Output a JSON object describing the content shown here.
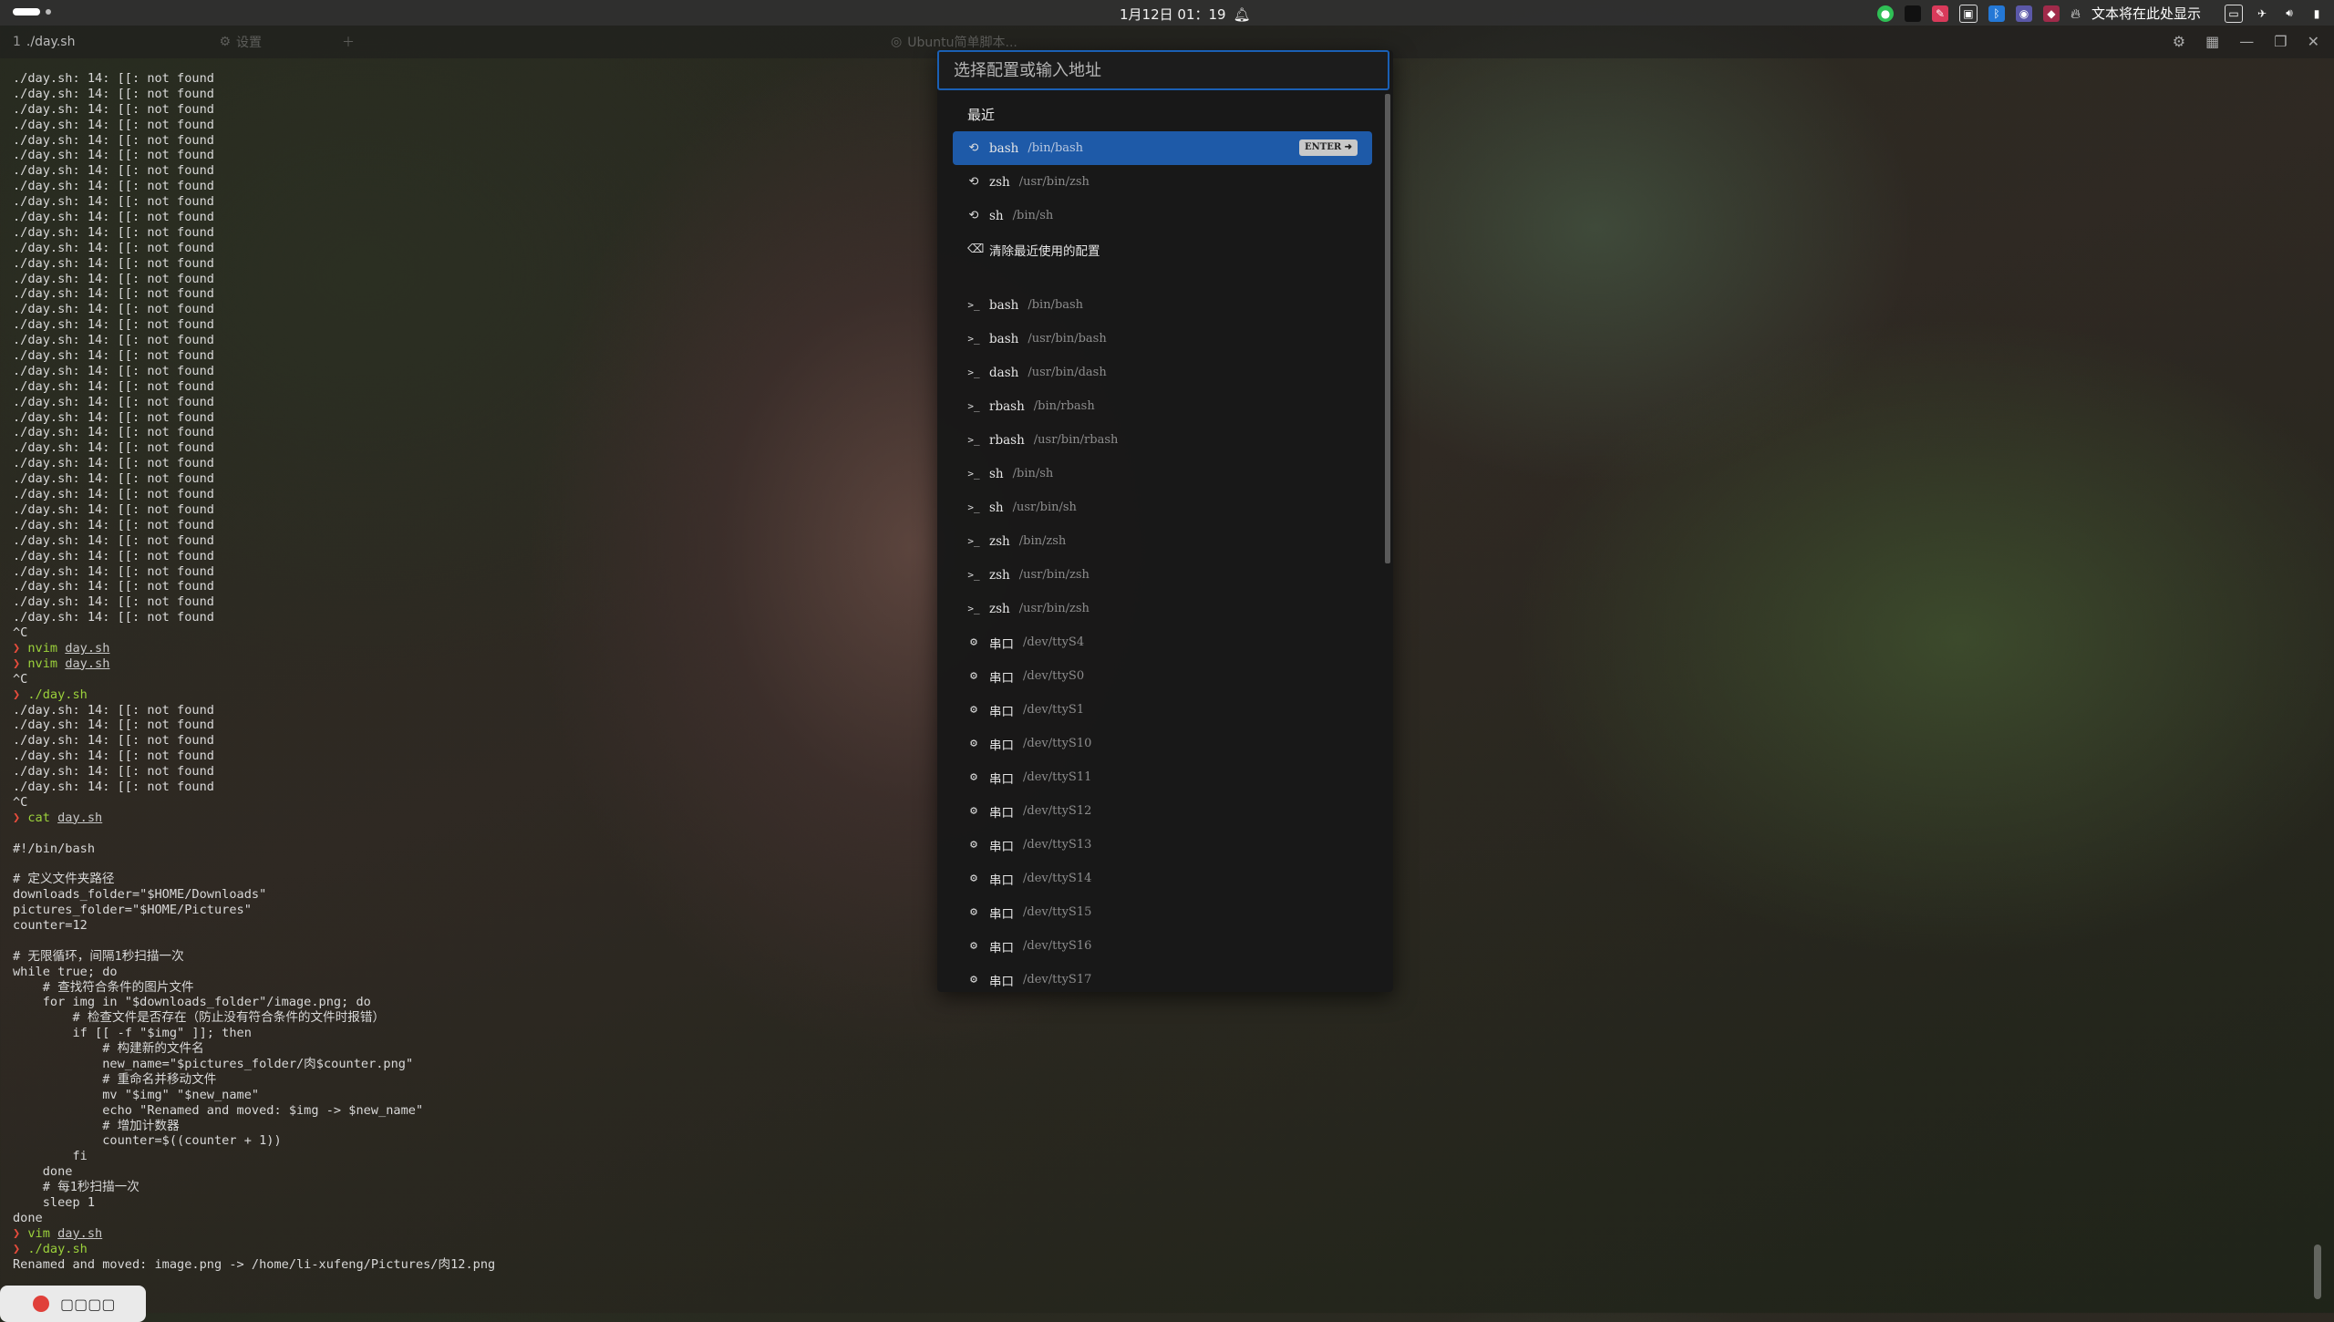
{
  "topbar": {
    "datetime": "1月12日 01：19",
    "tray_text": "文本将在此处显示",
    "tray_icons": [
      "wechat-icon",
      "app-square-icon",
      "app-red-icon",
      "app-window-icon",
      "bluetooth-icon",
      "app-bot-icon",
      "app-red2-icon",
      "flame-icon",
      "screen-icon",
      "network-icon",
      "volume-icon",
      "battery-icon"
    ]
  },
  "tabs": [
    {
      "idx": "1",
      "label": "./day.sh",
      "dim": false
    },
    {
      "idx": "",
      "label": "设置",
      "dim": true
    },
    {
      "idx": "",
      "label": "Ubuntu简单脚本...",
      "dim": true
    }
  ],
  "terminal": {
    "lines": [
      {
        "t": "out",
        "text": "./day.sh: 14: [[: not found"
      },
      {
        "t": "out",
        "text": "./day.sh: 14: [[: not found"
      },
      {
        "t": "out",
        "text": "./day.sh: 14: [[: not found"
      },
      {
        "t": "out",
        "text": "./day.sh: 14: [[: not found"
      },
      {
        "t": "out",
        "text": "./day.sh: 14: [[: not found"
      },
      {
        "t": "out",
        "text": "./day.sh: 14: [[: not found"
      },
      {
        "t": "out",
        "text": "./day.sh: 14: [[: not found"
      },
      {
        "t": "out",
        "text": "./day.sh: 14: [[: not found"
      },
      {
        "t": "out",
        "text": "./day.sh: 14: [[: not found"
      },
      {
        "t": "out",
        "text": "./day.sh: 14: [[: not found"
      },
      {
        "t": "out",
        "text": "./day.sh: 14: [[: not found"
      },
      {
        "t": "out",
        "text": "./day.sh: 14: [[: not found"
      },
      {
        "t": "out",
        "text": "./day.sh: 14: [[: not found"
      },
      {
        "t": "out",
        "text": "./day.sh: 14: [[: not found"
      },
      {
        "t": "out",
        "text": "./day.sh: 14: [[: not found"
      },
      {
        "t": "out",
        "text": "./day.sh: 14: [[: not found"
      },
      {
        "t": "out",
        "text": "./day.sh: 14: [[: not found"
      },
      {
        "t": "out",
        "text": "./day.sh: 14: [[: not found"
      },
      {
        "t": "out",
        "text": "./day.sh: 14: [[: not found"
      },
      {
        "t": "out",
        "text": "./day.sh: 14: [[: not found"
      },
      {
        "t": "out",
        "text": "./day.sh: 14: [[: not found"
      },
      {
        "t": "out",
        "text": "./day.sh: 14: [[: not found"
      },
      {
        "t": "out",
        "text": "./day.sh: 14: [[: not found"
      },
      {
        "t": "out",
        "text": "./day.sh: 14: [[: not found"
      },
      {
        "t": "out",
        "text": "./day.sh: 14: [[: not found"
      },
      {
        "t": "out",
        "text": "./day.sh: 14: [[: not found"
      },
      {
        "t": "out",
        "text": "./day.sh: 14: [[: not found"
      },
      {
        "t": "out",
        "text": "./day.sh: 14: [[: not found"
      },
      {
        "t": "out",
        "text": "./day.sh: 14: [[: not found"
      },
      {
        "t": "out",
        "text": "./day.sh: 14: [[: not found"
      },
      {
        "t": "out",
        "text": "./day.sh: 14: [[: not found"
      },
      {
        "t": "out",
        "text": "./day.sh: 14: [[: not found"
      },
      {
        "t": "out",
        "text": "./day.sh: 14: [[: not found"
      },
      {
        "t": "out",
        "text": "./day.sh: 14: [[: not found"
      },
      {
        "t": "out",
        "text": "./day.sh: 14: [[: not found"
      },
      {
        "t": "out",
        "text": "./day.sh: 14: [[: not found"
      },
      {
        "t": "out",
        "text": "^C"
      },
      {
        "t": "cmd",
        "cmd": "nvim",
        "arg": "day.sh"
      },
      {
        "t": "cmd",
        "cmd": "nvim",
        "arg": "day.sh"
      },
      {
        "t": "out",
        "text": "^C"
      },
      {
        "t": "cmd",
        "cmd": "./day.sh",
        "arg": ""
      },
      {
        "t": "out",
        "text": "./day.sh: 14: [[: not found"
      },
      {
        "t": "out",
        "text": "./day.sh: 14: [[: not found"
      },
      {
        "t": "out",
        "text": "./day.sh: 14: [[: not found"
      },
      {
        "t": "out",
        "text": "./day.sh: 14: [[: not found"
      },
      {
        "t": "out",
        "text": "./day.sh: 14: [[: not found"
      },
      {
        "t": "out",
        "text": "./day.sh: 14: [[: not found"
      },
      {
        "t": "out",
        "text": "^C"
      },
      {
        "t": "cmd",
        "cmd": "cat",
        "arg": "day.sh"
      },
      {
        "t": "out",
        "text": ""
      },
      {
        "t": "out",
        "text": "#!/bin/bash"
      },
      {
        "t": "out",
        "text": ""
      },
      {
        "t": "out",
        "text": "# 定义文件夹路径"
      },
      {
        "t": "out",
        "text": "downloads_folder=\"$HOME/Downloads\""
      },
      {
        "t": "out",
        "text": "pictures_folder=\"$HOME/Pictures\""
      },
      {
        "t": "out",
        "text": "counter=12"
      },
      {
        "t": "out",
        "text": ""
      },
      {
        "t": "out",
        "text": "# 无限循环，间隔1秒扫描一次"
      },
      {
        "t": "out",
        "text": "while true; do"
      },
      {
        "t": "out",
        "text": "    # 查找符合条件的图片文件"
      },
      {
        "t": "out",
        "text": "    for img in \"$downloads_folder\"/image.png; do"
      },
      {
        "t": "out",
        "text": "        # 检查文件是否存在（防止没有符合条件的文件时报错）"
      },
      {
        "t": "out",
        "text": "        if [[ -f \"$img\" ]]; then"
      },
      {
        "t": "out",
        "text": "            # 构建新的文件名"
      },
      {
        "t": "out",
        "text": "            new_name=\"$pictures_folder/肉$counter.png\""
      },
      {
        "t": "out",
        "text": "            # 重命名并移动文件"
      },
      {
        "t": "out",
        "text": "            mv \"$img\" \"$new_name\""
      },
      {
        "t": "out",
        "text": "            echo \"Renamed and moved: $img -> $new_name\""
      },
      {
        "t": "out",
        "text": "            # 增加计数器"
      },
      {
        "t": "out",
        "text": "            counter=$((counter + 1))"
      },
      {
        "t": "out",
        "text": "        fi"
      },
      {
        "t": "out",
        "text": "    done"
      },
      {
        "t": "out",
        "text": "    # 每1秒扫描一次"
      },
      {
        "t": "out",
        "text": "    sleep 1"
      },
      {
        "t": "out",
        "text": "done"
      },
      {
        "t": "cmd",
        "cmd": "vim",
        "arg": "day.sh"
      },
      {
        "t": "cmd",
        "cmd": "./day.sh",
        "arg": ""
      },
      {
        "t": "out",
        "text": "Renamed and moved: image.png -> /home/li-xufeng/Pictures/肉12.png"
      }
    ]
  },
  "palette": {
    "placeholder": "选择配置或输入地址",
    "recent_header": "最近",
    "enter_badge": "ENTER ➜",
    "recent": [
      {
        "name": "bash",
        "path": "/bin/bash",
        "icon": "history-icon"
      },
      {
        "name": "zsh",
        "path": "/usr/bin/zsh",
        "icon": "history-icon"
      },
      {
        "name": "sh",
        "path": "/bin/sh",
        "icon": "history-icon"
      }
    ],
    "clear_label": "清除最近使用的配置",
    "profiles": [
      {
        "name": "bash",
        "path": "/bin/bash",
        "icon": "terminal-icon"
      },
      {
        "name": "bash",
        "path": "/usr/bin/bash",
        "icon": "terminal-icon"
      },
      {
        "name": "dash",
        "path": "/usr/bin/dash",
        "icon": "terminal-icon"
      },
      {
        "name": "rbash",
        "path": "/bin/rbash",
        "icon": "terminal-icon"
      },
      {
        "name": "rbash",
        "path": "/usr/bin/rbash",
        "icon": "terminal-icon"
      },
      {
        "name": "sh",
        "path": "/bin/sh",
        "icon": "terminal-icon"
      },
      {
        "name": "sh",
        "path": "/usr/bin/sh",
        "icon": "terminal-icon"
      },
      {
        "name": "zsh",
        "path": "/bin/zsh",
        "icon": "terminal-icon"
      },
      {
        "name": "zsh",
        "path": "/usr/bin/zsh",
        "icon": "terminal-icon"
      },
      {
        "name": "zsh",
        "path": "/usr/bin/zsh",
        "icon": "terminal-icon"
      },
      {
        "name": "串口",
        "path": "/dev/ttyS4",
        "icon": "serial-icon"
      },
      {
        "name": "串口",
        "path": "/dev/ttyS0",
        "icon": "serial-icon"
      },
      {
        "name": "串口",
        "path": "/dev/ttyS1",
        "icon": "serial-icon"
      },
      {
        "name": "串口",
        "path": "/dev/ttyS10",
        "icon": "serial-icon"
      },
      {
        "name": "串口",
        "path": "/dev/ttyS11",
        "icon": "serial-icon"
      },
      {
        "name": "串口",
        "path": "/dev/ttyS12",
        "icon": "serial-icon"
      },
      {
        "name": "串口",
        "path": "/dev/ttyS13",
        "icon": "serial-icon"
      },
      {
        "name": "串口",
        "path": "/dev/ttyS14",
        "icon": "serial-icon"
      },
      {
        "name": "串口",
        "path": "/dev/ttyS15",
        "icon": "serial-icon"
      },
      {
        "name": "串口",
        "path": "/dev/ttyS16",
        "icon": "serial-icon"
      },
      {
        "name": "串口",
        "path": "/dev/ttyS17",
        "icon": "serial-icon"
      }
    ]
  },
  "colors": {
    "accent": "#1e5aa8",
    "prompt": "#e74c3c",
    "command": "#9bd13b"
  }
}
